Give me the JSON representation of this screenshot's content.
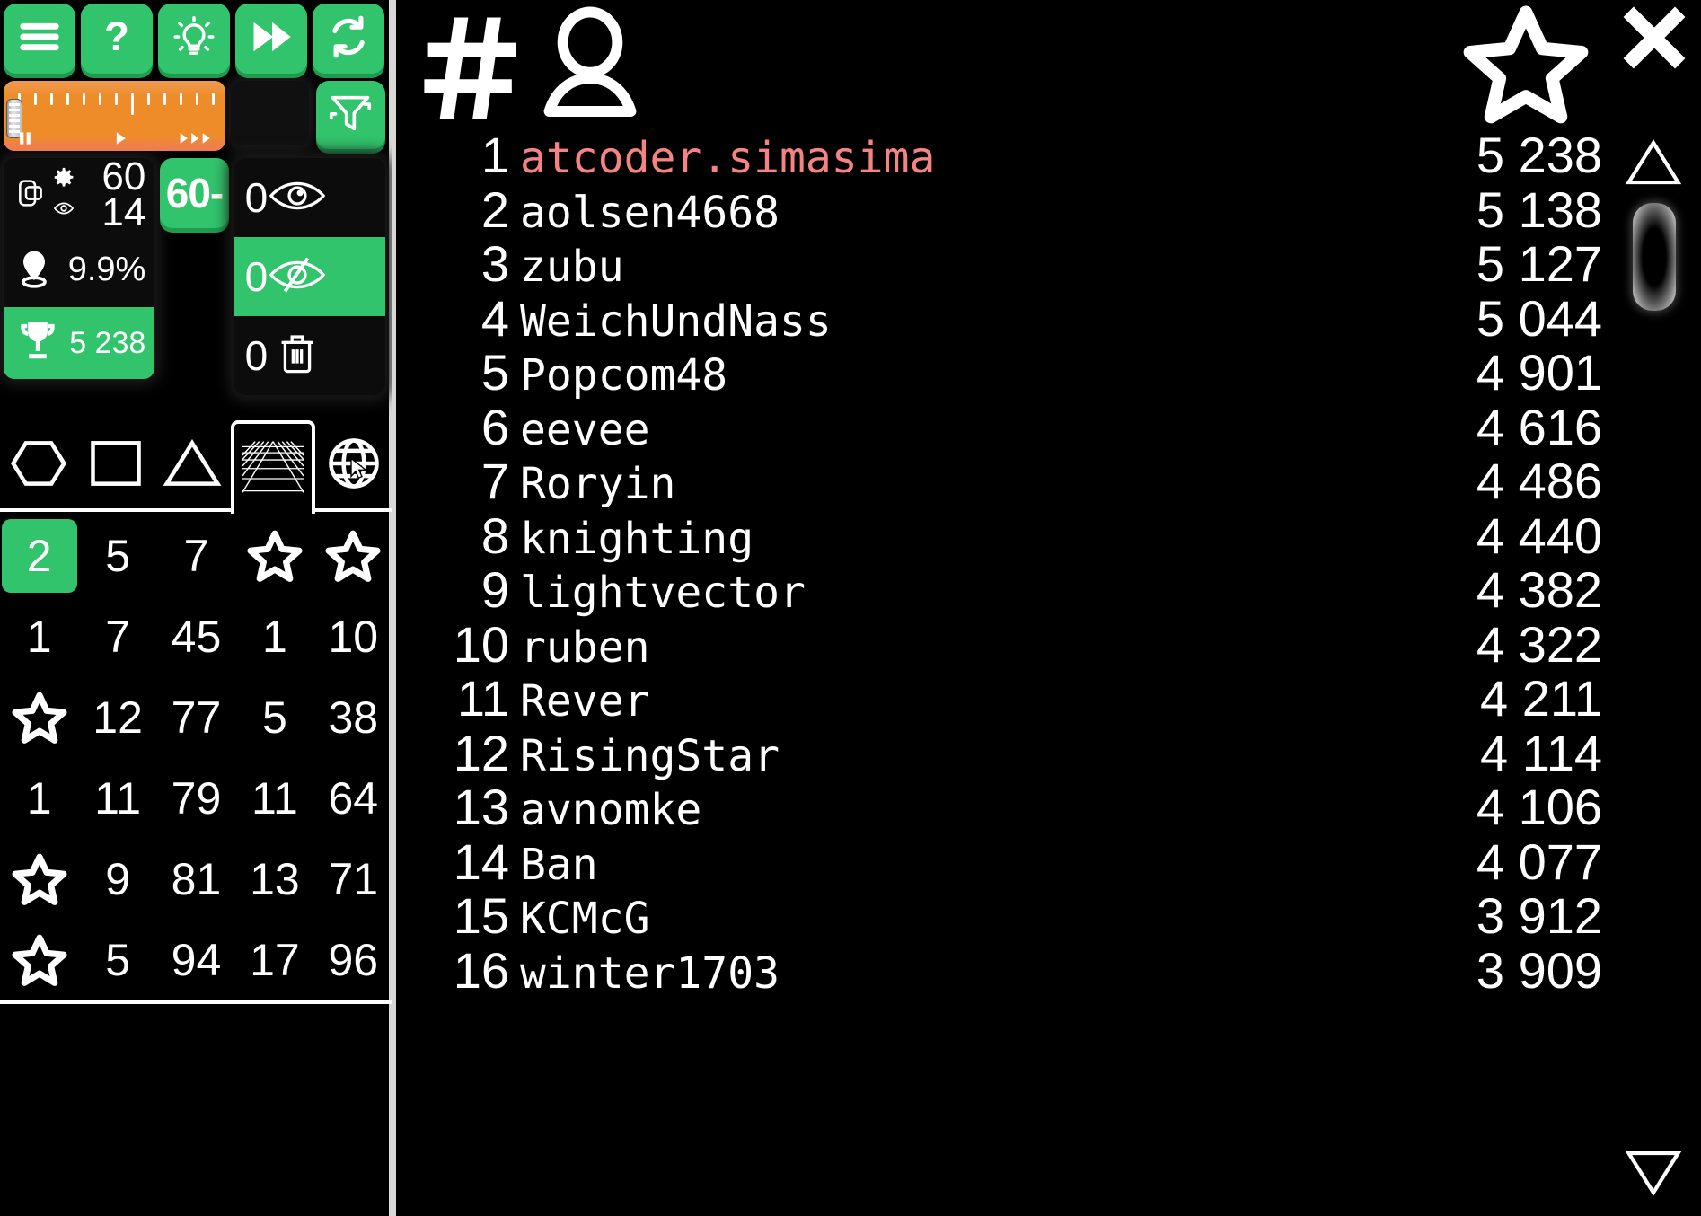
{
  "toolbar": {
    "buttons": [
      {
        "name": "menu-button",
        "icon": "hamburger-menu-icon"
      },
      {
        "name": "help-button",
        "icon": "question-mark-icon"
      },
      {
        "name": "hint-button",
        "icon": "lightbulb-icon"
      },
      {
        "name": "fast-forward-button",
        "icon": "fast-forward-icon"
      },
      {
        "name": "restart-button",
        "icon": "refresh-loop-icon"
      }
    ]
  },
  "slider": {
    "name": "speed-slider",
    "pause_icon": "pause-icon",
    "play_icon": "play-icon",
    "fastforward_icon": "triple-play-icon",
    "color": "#ee8c2a"
  },
  "filter_button": {
    "icon": "funnel-icon",
    "label": ""
  },
  "stats": {
    "layers_icon": "layers-icon",
    "gear_icon": "gear-icon",
    "eye_icon": "eye-icon",
    "count_top": "60",
    "count_bottom": "14",
    "location_icon": "map-pin-icon",
    "percent": "9.9%",
    "trophy_icon": "trophy-icon",
    "trophy_value": "5 238"
  },
  "sixty_button": {
    "label": "60-"
  },
  "visibility": [
    {
      "value": "0",
      "icon": "eye-icon",
      "active": false
    },
    {
      "value": "0",
      "icon": "eye-off-icon",
      "active": true
    },
    {
      "value": "0",
      "icon": "trash-icon",
      "active": false
    }
  ],
  "shape_tabs": [
    {
      "name": "tab-hexagon",
      "icon": "hexagon-icon",
      "selected": false
    },
    {
      "name": "tab-square",
      "icon": "square-icon",
      "selected": false
    },
    {
      "name": "tab-triangle",
      "icon": "triangle-icon",
      "selected": false
    },
    {
      "name": "tab-grid",
      "icon": "perspective-grid-icon",
      "selected": true
    },
    {
      "name": "tab-globe",
      "icon": "globe-icon",
      "selected": false
    }
  ],
  "number_grid": {
    "rows": [
      [
        {
          "t": "2",
          "hl": true
        },
        {
          "t": "5"
        },
        {
          "t": "7"
        },
        {
          "t": "star"
        },
        {
          "t": "star"
        }
      ],
      [
        {
          "t": "1"
        },
        {
          "t": "7"
        },
        {
          "t": "45"
        },
        {
          "t": "1"
        },
        {
          "t": "10"
        }
      ],
      [
        {
          "t": "star"
        },
        {
          "t": "12"
        },
        {
          "t": "77"
        },
        {
          "t": "5"
        },
        {
          "t": "38"
        }
      ],
      [
        {
          "t": "1"
        },
        {
          "t": "11"
        },
        {
          "t": "79"
        },
        {
          "t": "11"
        },
        {
          "t": "64"
        }
      ],
      [
        {
          "t": "star"
        },
        {
          "t": "9"
        },
        {
          "t": "81"
        },
        {
          "t": "13"
        },
        {
          "t": "71"
        }
      ],
      [
        {
          "t": "star"
        },
        {
          "t": "5"
        },
        {
          "t": "94"
        },
        {
          "t": "17"
        },
        {
          "t": "96"
        }
      ]
    ]
  },
  "leaderboard": {
    "header": {
      "rank_icon": "hash-icon",
      "user_icon": "person-icon",
      "star_icon": "star-outline-icon",
      "close_icon": "close-x-icon"
    },
    "entries": [
      {
        "rank": "1",
        "name": "atcoder.simasima",
        "score": "5 238",
        "highlight": true
      },
      {
        "rank": "2",
        "name": "aolsen4668",
        "score": "5 138",
        "highlight": false
      },
      {
        "rank": "3",
        "name": "zubu",
        "score": "5 127",
        "highlight": false
      },
      {
        "rank": "4",
        "name": "WeichUndNass",
        "score": "5 044",
        "highlight": false
      },
      {
        "rank": "5",
        "name": "Popcom48",
        "score": "4 901",
        "highlight": false
      },
      {
        "rank": "6",
        "name": "eevee",
        "score": "4 616",
        "highlight": false
      },
      {
        "rank": "7",
        "name": "Roryin",
        "score": "4 486",
        "highlight": false
      },
      {
        "rank": "8",
        "name": "knighting",
        "score": "4 440",
        "highlight": false
      },
      {
        "rank": "9",
        "name": "lightvector",
        "score": "4 382",
        "highlight": false
      },
      {
        "rank": "10",
        "name": "ruben",
        "score": "4 322",
        "highlight": false
      },
      {
        "rank": "11",
        "name": "Rever",
        "score": "4 211",
        "highlight": false
      },
      {
        "rank": "12",
        "name": "RisingStar",
        "score": "4 114",
        "highlight": false
      },
      {
        "rank": "13",
        "name": "avnomke",
        "score": "4 106",
        "highlight": false
      },
      {
        "rank": "14",
        "name": "Ban",
        "score": "4 077",
        "highlight": false
      },
      {
        "rank": "15",
        "name": "KCMcG",
        "score": "3 912",
        "highlight": false
      },
      {
        "rank": "16",
        "name": "winter1703",
        "score": "3 909",
        "highlight": false
      }
    ]
  },
  "scrollbar": {
    "up_icon": "triangle-up-icon",
    "down_icon": "triangle-down-icon"
  },
  "colors": {
    "accent_green": "#32c46c",
    "slider_orange": "#ee8c2a",
    "highlight_name": "#f58383",
    "background": "#000000"
  }
}
